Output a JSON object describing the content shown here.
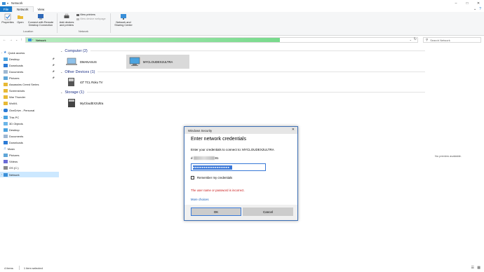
{
  "window": {
    "title": "Network"
  },
  "menubar": {
    "file": "File",
    "tabs": [
      "Network",
      "View"
    ]
  },
  "ribbon": {
    "location": {
      "group_label": "Location",
      "properties": "Properties",
      "open": "Open",
      "connect_remote": "Connect with Remote Desktop Connection"
    },
    "network": {
      "group_label": "Network",
      "add_devices": "Add devices and printers",
      "view_printers": "View printers",
      "view_device_webpage": "View device webpage",
      "sharing_center": "Network and Sharing Center"
    }
  },
  "address": {
    "path": "Network",
    "search_placeholder": "Search Network"
  },
  "sidebar": {
    "items": [
      {
        "label": "Quick access",
        "icon": "star-icon",
        "pinned": false
      },
      {
        "label": "Desktop",
        "icon": "folder-icon",
        "pinned": true
      },
      {
        "label": "Downloads",
        "icon": "download-icon",
        "pinned": true
      },
      {
        "label": "Documents",
        "icon": "document-icon",
        "pinned": true
      },
      {
        "label": "Pictures",
        "icon": "pictures-icon",
        "pinned": true
      },
      {
        "label": "Assassins Creed Series",
        "icon": "folder-icon",
        "pinned": false
      },
      {
        "label": "Screenshots",
        "icon": "folder-icon",
        "pinned": false
      },
      {
        "label": "War Thunder",
        "icon": "folder-icon",
        "pinned": false
      },
      {
        "label": "WoWL",
        "icon": "folder-icon",
        "pinned": false
      },
      {
        "label": "OneDrive - Personal",
        "icon": "cloud-icon",
        "pinned": false
      },
      {
        "label": "This PC",
        "icon": "computer-icon",
        "pinned": false
      },
      {
        "label": "3D Objects",
        "icon": "cube-icon",
        "pinned": false
      },
      {
        "label": "Desktop",
        "icon": "folder-icon",
        "pinned": false
      },
      {
        "label": "Documents",
        "icon": "document-icon",
        "pinned": false
      },
      {
        "label": "Downloads",
        "icon": "download-icon",
        "pinned": false
      },
      {
        "label": "Music",
        "icon": "music-icon",
        "pinned": false
      },
      {
        "label": "Pictures",
        "icon": "pictures-icon",
        "pinned": false
      },
      {
        "label": "Videos",
        "icon": "video-icon",
        "pinned": false
      },
      {
        "label": "OS (C:)",
        "icon": "drive-icon",
        "pinned": false
      },
      {
        "label": "Network",
        "icon": "network-icon",
        "pinned": false
      }
    ]
  },
  "groups": {
    "computer": {
      "label": "Computer (2)",
      "items": [
        "DMANASUS",
        "MYCLOUDEX2ULTRA"
      ]
    },
    "other": {
      "label": "Other Devices (1)",
      "items": [
        "43\" TCL Roku TV"
      ]
    },
    "storage": {
      "label": "Storage (1)",
      "items": [
        "MyCloudEX2Ultra"
      ]
    }
  },
  "preview": {
    "text": "No preview available."
  },
  "status": {
    "count": "4 items",
    "selected": "1 item selected"
  },
  "dialog": {
    "title": "Windows Security",
    "heading": "Enter network credentials",
    "prompt": "Enter your credentials to connect to: MYCLOUDEX2ULTRA",
    "user_prefix": "d",
    "user_suffix": "81",
    "password_mask": "●●●●●●●●●●●●●●●●●●●●",
    "remember": "Remember my credentials",
    "error": "The user name or password is incorrect.",
    "more_choices": "More choices",
    "ok": "OK",
    "cancel": "Cancel"
  },
  "colors": {
    "accent": "#1979ca",
    "address_fill": "#78da8c",
    "error": "#c81616",
    "link": "#0a55b6"
  }
}
